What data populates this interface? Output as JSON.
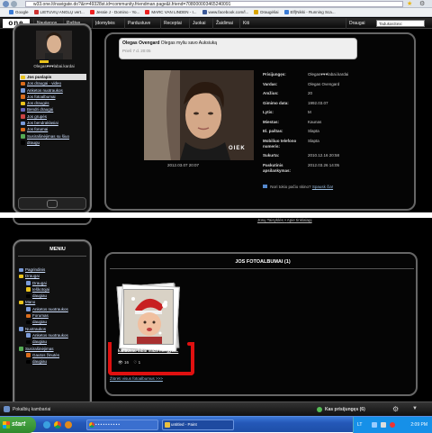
{
  "browser": {
    "url": "w33.one.lt/navigate.do?&n=49328st.id=community.friendman.page&t.friend=708000003465240091"
  },
  "bookmarks": [
    {
      "label": "Google",
      "color": "#3a7bd5"
    },
    {
      "label": "LIETUVIŲ ANGLŲ vert...",
      "color": "#c33"
    },
    {
      "label": "Jessie J - Domino - Yo...",
      "color": "#e22"
    },
    {
      "label": "MARC VAN LINDEN - I...",
      "color": "#e22"
    },
    {
      "label": "www.facebook.com/l...",
      "color": "#3b5998"
    },
    {
      "label": "Draugėliai",
      "color": "#d8a400"
    },
    {
      "label": "Elf(Nikki - Running Sca...",
      "color": "#3a7bd5"
    }
  ],
  "site": {
    "logo": "one",
    "nav": [
      "Naujienos",
      "Paštas",
      "Įdomybės",
      "Pardustuve",
      "Receptai",
      "Juokai",
      "Žaidimai",
      "Kiti"
    ],
    "nav_right": "Draugai",
    "search_placeholder": "TadukasSexi"
  },
  "top_menu": {
    "username": "Olegas♥♥♥labai.kardai",
    "items": [
      {
        "label": "Jos puslapis",
        "active": true,
        "color": "#e9c21c"
      },
      {
        "label": "Jos draugai · video",
        "active": false,
        "color": "#d96b1c"
      },
      {
        "label": "Anketos nuotraukos",
        "active": false,
        "color": "#7a9bd9"
      },
      {
        "label": "Jos fotoalbumai",
        "active": false,
        "color": "#d96b1c"
      },
      {
        "label": "Jos draugės",
        "active": false,
        "color": "#e9c21c"
      },
      {
        "label": "Bendri draugai",
        "active": false,
        "color": "#66b"
      },
      {
        "label": "Jos grupės",
        "active": false,
        "color": "#c44"
      },
      {
        "label": "Jos bendraklasiai",
        "active": false,
        "color": "#7a9bd9"
      },
      {
        "label": "Jos forumai",
        "active": false,
        "color": "#d96b1c"
      },
      {
        "label": "Susirašinėjimas su šiuo",
        "active": false,
        "color": "#5a5"
      },
      {
        "label": "draugu",
        "active": false,
        "color": "#000"
      }
    ]
  },
  "status": {
    "author": "Olegas Ovengard",
    "text": "Olegas myliu savo Auksiuką",
    "time": "Prieš 7 d. 20:05"
  },
  "photo": {
    "date": "2012.03.07 20:07",
    "watermark": "OIEK"
  },
  "profile_info": [
    {
      "label": "Prisijungęs:",
      "value": "Olegas♥♥♥labai.kardai"
    },
    {
      "label": "Vardas:",
      "value": "Olegas Ovengard"
    },
    {
      "label": "Amžius:",
      "value": "20"
    },
    {
      "label": "Gimimo data:",
      "value": "1992.03.07"
    },
    {
      "label": "Lytis:",
      "value": "M"
    },
    {
      "label": "Miestas:",
      "value": "Kaunas"
    },
    {
      "label": "El. paštas:",
      "value": "Slapta"
    },
    {
      "label": "Mobiliuo telefono numeris:",
      "value": "Slapta"
    },
    {
      "label": "Sukurta:",
      "value": "2010.12.16 20:58"
    },
    {
      "label": "Paskutinis apsilankymas:",
      "value": "2012.03.26 14:05"
    }
  ],
  "skin": {
    "text": "Nori tokio pačio skino?",
    "link": "Spausk čia!"
  },
  "bottom_menu": {
    "title": "MENIU",
    "items": [
      {
        "label": "Pagrindinis",
        "color": "#7a9bd9",
        "indent": 0
      },
      {
        "label": "Draugai",
        "color": "#e9c21c",
        "indent": 0
      },
      {
        "label": "Draugai",
        "color": "#7a9bd9",
        "indent": 1
      },
      {
        "label": "Ieškotojai",
        "color": "#e9c21c",
        "indent": 1
      },
      {
        "label": "daugiau",
        "color": "#000",
        "indent": 1
      },
      {
        "label": "Mano",
        "color": "#e9c21c",
        "indent": 0
      },
      {
        "label": "Anketos nuotraukos",
        "color": "#7a9bd9",
        "indent": 1
      },
      {
        "label": "Forumas",
        "color": "#d96b1c",
        "indent": 1
      },
      {
        "label": "daugiau",
        "color": "#000",
        "indent": 1
      },
      {
        "label": "Nuotraukos",
        "color": "#7a9bd9",
        "indent": 0
      },
      {
        "label": "Anketos nuotraukos",
        "color": "#7a9bd9",
        "indent": 1
      },
      {
        "label": "daugiau",
        "color": "#000",
        "indent": 1
      },
      {
        "label": "Susirašinėjimas",
        "color": "#5a5",
        "indent": 0
      },
      {
        "label": "Gautos žinutės",
        "color": "#d96b1c",
        "indent": 1
      },
      {
        "label": "daugiau",
        "color": "#000",
        "indent": 1
      }
    ]
  },
  "gallery": {
    "title": "JOS FOTOALBUMAI (1)",
    "album_caption": "kai buvau labai maza mergytė...",
    "views": "16",
    "comments": "1",
    "see_all": "Žiūrėti visus fotoalbumus >>>"
  },
  "top_footer_links": {
    "left": "Jūsų Taisyklės",
    "right": "Apie tinklalapį"
  },
  "bottom_bar": {
    "left": "Pokalbių kambariai",
    "right": "Kas prisijungęs (6)"
  },
  "taskbar": {
    "start": "start",
    "tasks": [
      "• • • • • • • • • •",
      "untitled - Paint"
    ],
    "lang": "LT",
    "clock": "2:09 PM"
  },
  "colors": {
    "accent_red": "#e01010",
    "link": "#99bbdd"
  }
}
